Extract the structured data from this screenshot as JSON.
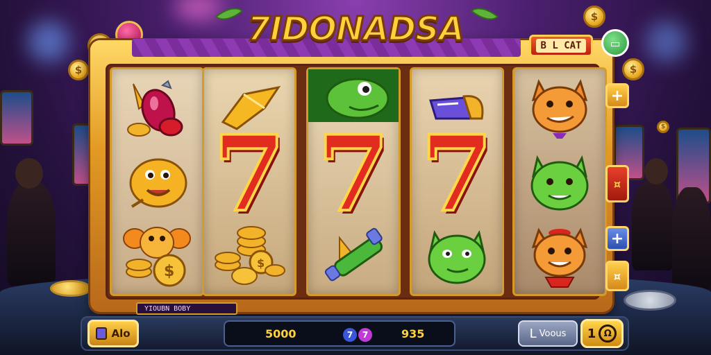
{
  "game": {
    "title": "7IDONADSA",
    "badge_label": "B L CAT",
    "label_strip": "YIOUBN BOBY"
  },
  "reels": [
    {
      "symbols": [
        "potion-icon",
        "gold-fish-icon",
        "dog-with-coins-icon"
      ]
    },
    {
      "symbols": [
        "gold-arrow-icon",
        "seven",
        "coin-stack-icon"
      ],
      "seven": "7"
    },
    {
      "symbols": [
        "green-frog-icon",
        "seven",
        "green-bottle-icon"
      ],
      "seven": "7"
    },
    {
      "symbols": [
        "purple-horn-icon",
        "seven",
        "green-cat-icon"
      ],
      "seven": "7"
    },
    {
      "symbols": [
        "orange-cat-icon",
        "green-cat-icon",
        "orange-cat-icon"
      ]
    }
  ],
  "side_buttons": {
    "plus_top": "+",
    "red_label": "¤",
    "plus_blue": "+",
    "bottom": "¤"
  },
  "controls": {
    "auto_label": "Alo",
    "display_left": "5000",
    "display_right": "935",
    "display_icon1": "7",
    "display_icon2": "7",
    "voices_label": "Voous",
    "voices_prefix": "L",
    "spin_value": "1",
    "spin_icon": "Ω"
  },
  "colors": {
    "frame_gold": "#e39a23",
    "seven_red": "#e12c1f",
    "background_purple": "#4a1f6e"
  }
}
